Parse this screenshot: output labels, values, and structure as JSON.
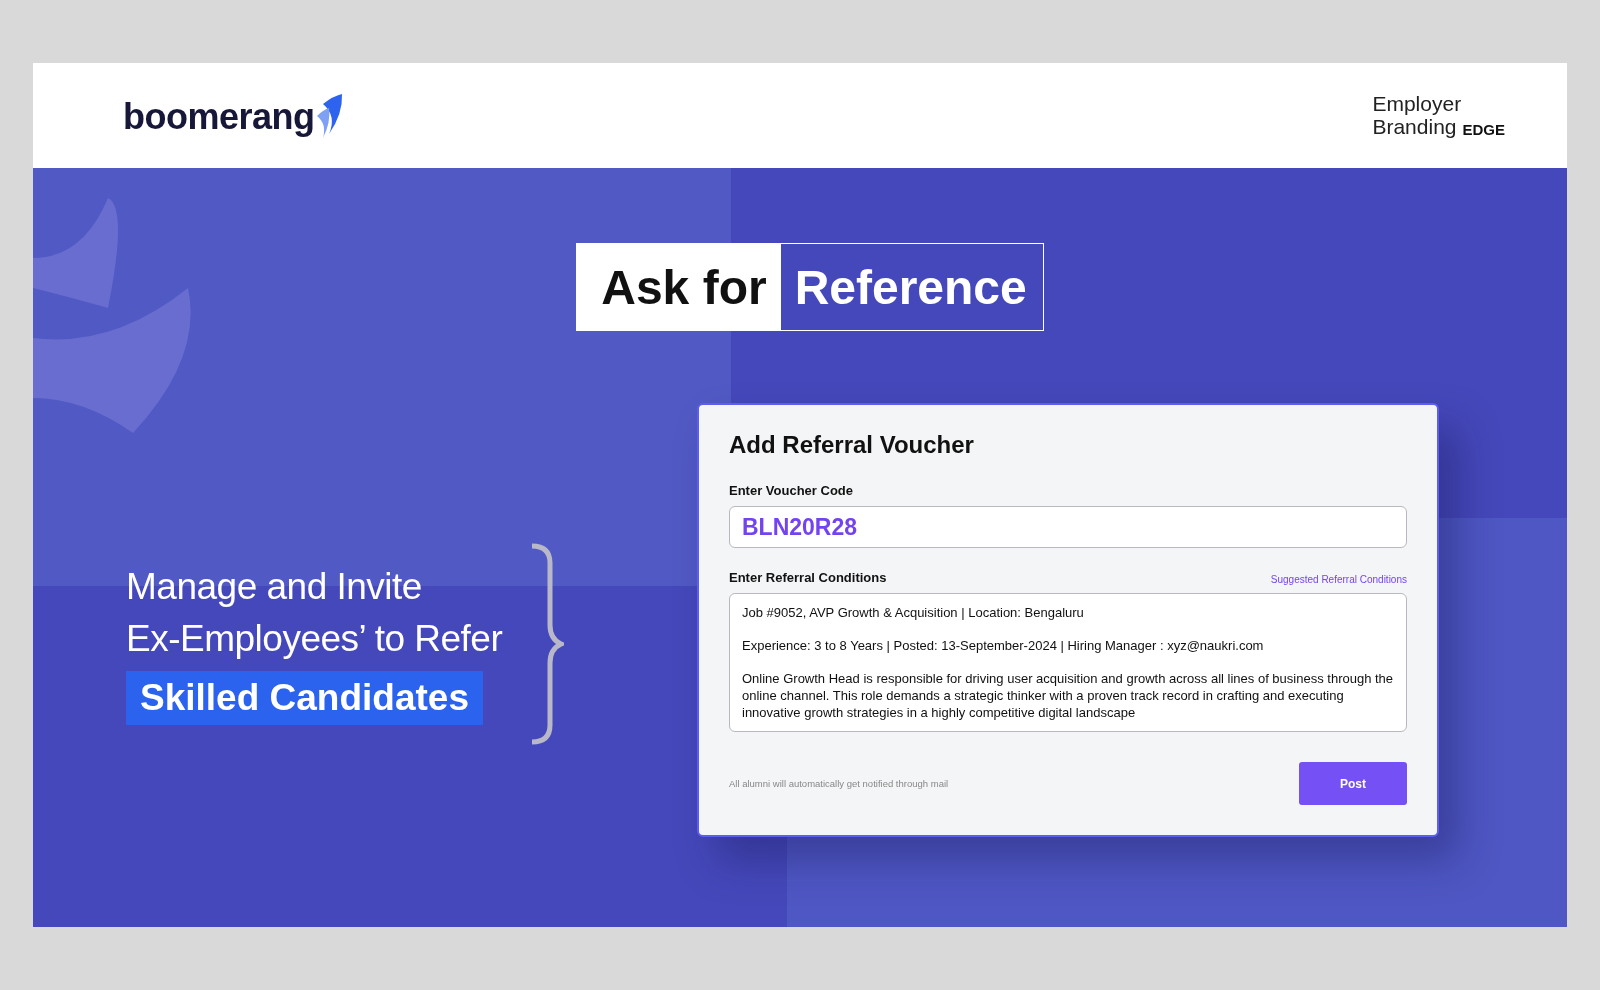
{
  "header": {
    "logo": "boomerang",
    "brand_line_1": "Employer",
    "brand_line_2": "Branding",
    "brand_mark": "EDGE"
  },
  "headline": {
    "plain": "Ask for",
    "highlight": "Reference"
  },
  "tagline": {
    "line_1": "Manage and Invite",
    "line_2": "Ex-Employees’ to Refer",
    "highlight": "Skilled Candidates"
  },
  "card": {
    "title": "Add Referral Voucher",
    "voucher_label": "Enter Voucher Code",
    "voucher_value": "BLN20R28",
    "conditions_label": "Enter Referral Conditions",
    "suggested_link": "Suggested Referral Conditions",
    "conditions": [
      "Job #9052, AVP Growth & Acquisition | Location: Bengaluru",
      "Experience: 3 to 8 Years | Posted: 13-September-2024 | Hiring Manager : xyz@naukri.com",
      "Online Growth Head is responsible for driving user acquisition and growth across all lines of business through the online channel. This role demands a strategic thinker with a proven track record in crafting and executing innovative growth strategies in a highly competitive digital landscape"
    ],
    "note": "All alumni will automatically get notified through mail",
    "post_button": "Post"
  }
}
